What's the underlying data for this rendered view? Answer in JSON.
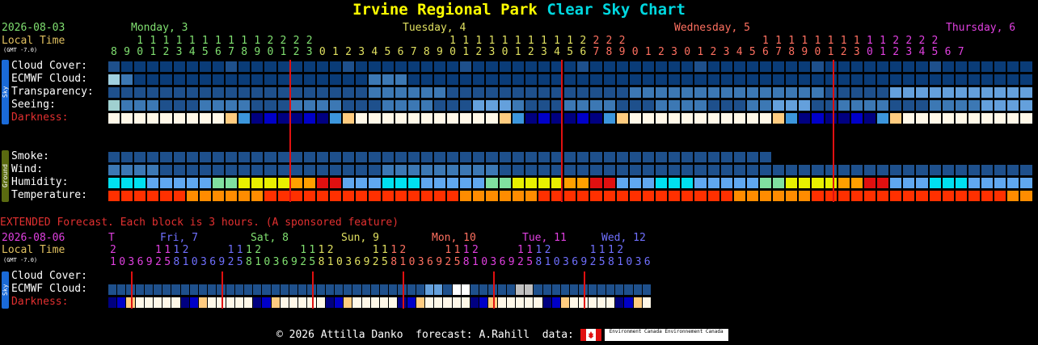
{
  "title": {
    "location": "Irvine Regional Park",
    "chart": "Clear Sky Chart"
  },
  "main": {
    "date": "2026-08-03",
    "local_time": "Local Time",
    "gmt": "(GMT -7.0)",
    "days": [
      {
        "label": "Monday, 3",
        "color": "#80e070"
      },
      {
        "label": "Tuesday, 4",
        "color": "#e0e060"
      },
      {
        "label": "Wednesday, 5",
        "color": "#ff7060"
      },
      {
        "label": "Thursday, 6",
        "color": "#e040e0"
      }
    ],
    "hour_tens": "        11111111111122222       11111111111122222       11111111111122222       1111111",
    "hour_ones": "890123456789012301234567890123012345678901230123456789012301234567",
    "rows": [
      "Cloud Cover:",
      "ECMWF Cloud:",
      "Transparency:",
      "Seeing:",
      "Darkness:"
    ],
    "ground_rows": [
      "Smoke:",
      "Wind:",
      "Humidity:",
      "Temperature:"
    ],
    "sky_tag": "Sky",
    "ground_tag": "Ground"
  },
  "extended": {
    "heading": "EXTENDED Forecast. Each block is 3 hours. (A sponsored feature)",
    "date": "2026-08-06",
    "local_time": "Local Time",
    "gmt": "(GMT -7.0)",
    "days": [
      {
        "label": "T",
        "color": "#e040e0"
      },
      {
        "label": "Fri, 7",
        "color": "#7070ff"
      },
      {
        "label": "Sat, 8",
        "color": "#80e070"
      },
      {
        "label": "Sun, 9",
        "color": "#e0e060"
      },
      {
        "label": "Mon, 10",
        "color": "#ff7060"
      },
      {
        "label": "Tue, 11",
        "color": "#e040e0"
      },
      {
        "label": "Wed, 12",
        "color": "#7070ff"
      }
    ],
    "rows": [
      "Cloud Cover:",
      "ECMWF Cloud:",
      "Darkness:"
    ],
    "sky_tag": "Sky"
  },
  "footer": {
    "text": "© 2026 Attilla Danko  forecast: A.Rahill  data:",
    "ec1": "Environment Canada",
    "ec2": "Environnement Canada"
  },
  "colors": {
    "blue0": "#0a3c78",
    "blue1": "#1e508c",
    "blue2": "#3c78b4",
    "blue3": "#64a0dc",
    "midnight": "#0000c8",
    "ecmwf_line": "#e01010"
  }
}
